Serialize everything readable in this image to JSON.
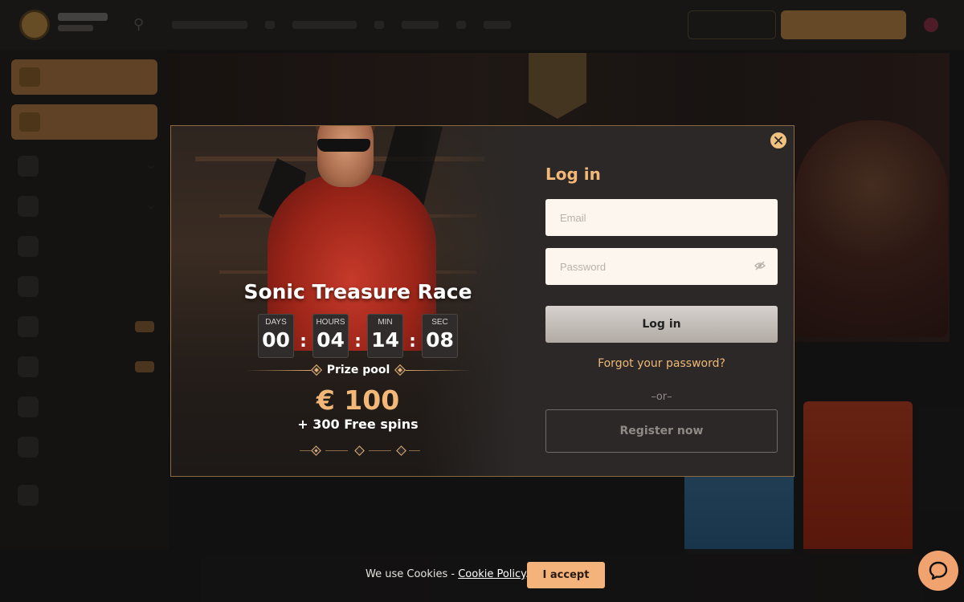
{
  "colors": {
    "accent": "#f3b878",
    "modal_border": "#8a6a3e",
    "modal_bg": "#2b2827",
    "accept_button": "#f3b37b",
    "chat_button": "#f0a36e"
  },
  "promo": {
    "title": "Sonic Treasure Race",
    "countdown": [
      {
        "label": "DAYS",
        "value": "00"
      },
      {
        "label": "HOURS",
        "value": "04"
      },
      {
        "label": "MIN",
        "value": "14"
      },
      {
        "label": "SEC",
        "value": "08"
      }
    ],
    "separator": ":",
    "prize_label": "Prize pool",
    "prize_amount": "€ 100",
    "prize_extra": "+ 300 Free spins",
    "slides_total": 3,
    "slide_active": 1
  },
  "login": {
    "title": "Log in",
    "email_placeholder": "Email",
    "password_placeholder": "Password",
    "submit_label": "Log in",
    "forgot_label": "Forgot your password?",
    "or_label": "–or–",
    "register_label": "Register now"
  },
  "cookie": {
    "text": "We use Cookies - ",
    "link": "Cookie Policy",
    "suffix": ".",
    "accept_label": "I accept"
  },
  "icons": {
    "close": "close-icon",
    "eye": "eye-icon",
    "chat": "chat-icon",
    "search": "search-icon"
  }
}
